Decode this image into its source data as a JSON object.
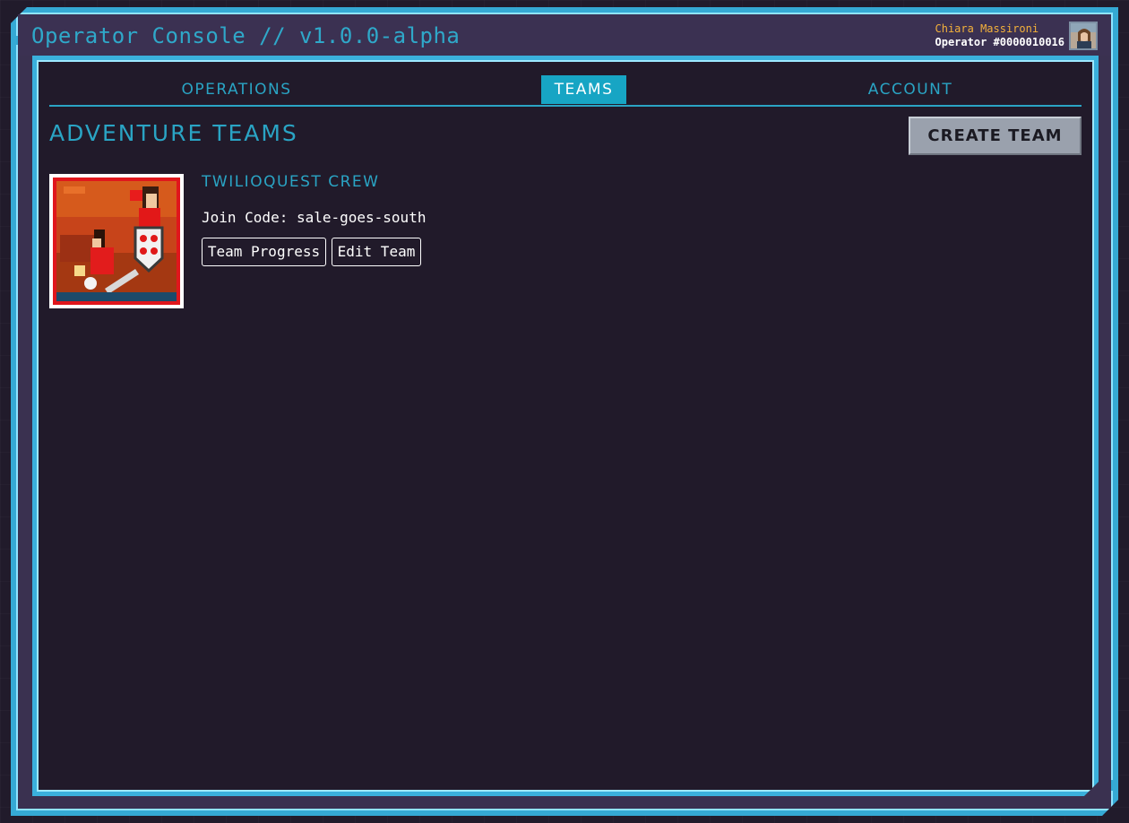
{
  "header": {
    "app_title": "Operator Console // v1.0.0-alpha",
    "user_name": "Chiara Massironi",
    "operator_id": "Operator #0000010016"
  },
  "tabs": [
    {
      "label": "OPERATIONS",
      "active": false
    },
    {
      "label": "TEAMS",
      "active": true
    },
    {
      "label": "ACCOUNT",
      "active": false
    }
  ],
  "main": {
    "section_title": "ADVENTURE TEAMS",
    "create_team_label": "CREATE TEAM"
  },
  "team": {
    "name": "TWILIOQUEST CREW",
    "join_code_text": "Join Code: sale-goes-south",
    "progress_label": "Team Progress",
    "edit_label": "Edit Team"
  },
  "colors": {
    "accent": "#2aa4c4",
    "frame": "#35a9d4",
    "background": "#211a2a",
    "user_name": "#f3b13b",
    "active_tab": "#17a5c4"
  }
}
